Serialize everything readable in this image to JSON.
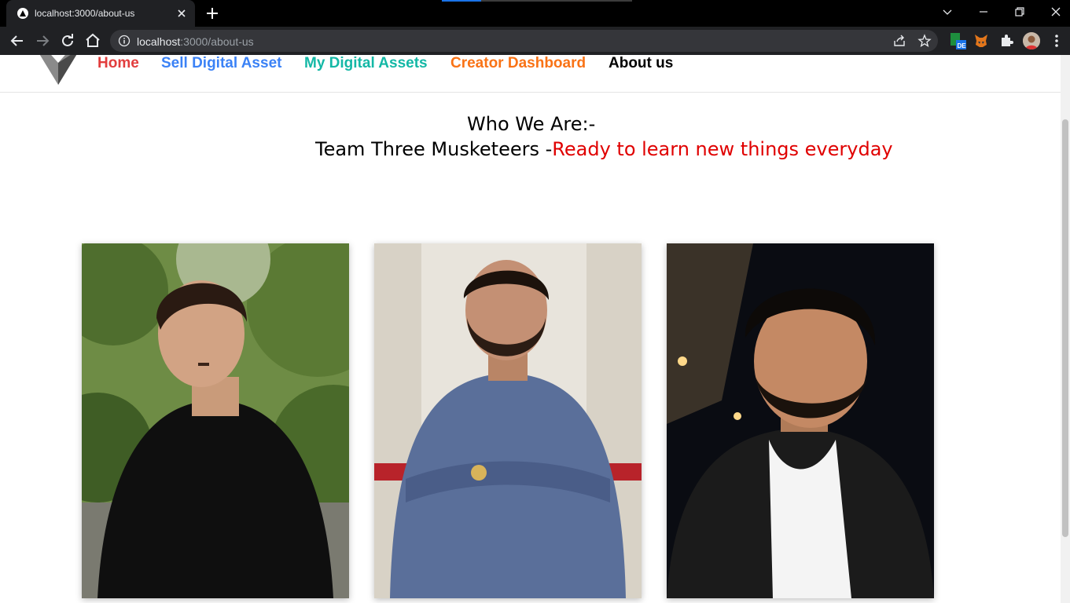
{
  "browser": {
    "tab_title": "localhost:3000/about-us",
    "url_host": "localhost",
    "url_rest": ":3000/about-us",
    "extension_badge": "DE"
  },
  "nav": {
    "links": [
      {
        "label": "Home",
        "color": "#e23d3d"
      },
      {
        "label": "Sell Digital Asset",
        "color": "#3b82f6"
      },
      {
        "label": "My Digital Assets",
        "color": "#14b8a6"
      },
      {
        "label": "Creator Dashboard",
        "color": "#f97316"
      },
      {
        "label": "About us",
        "color": "#000000"
      }
    ]
  },
  "about": {
    "heading": "Who We Are:-",
    "tagline_prefix": "Team Three Musketeers -",
    "tagline_accent": "Ready to learn new things everyday",
    "accent_color": "#e00000"
  },
  "team": [
    {
      "photo": "member-photo-outdoor-green"
    },
    {
      "photo": "member-photo-checked-shirt"
    },
    {
      "photo": "member-photo-night"
    }
  ]
}
